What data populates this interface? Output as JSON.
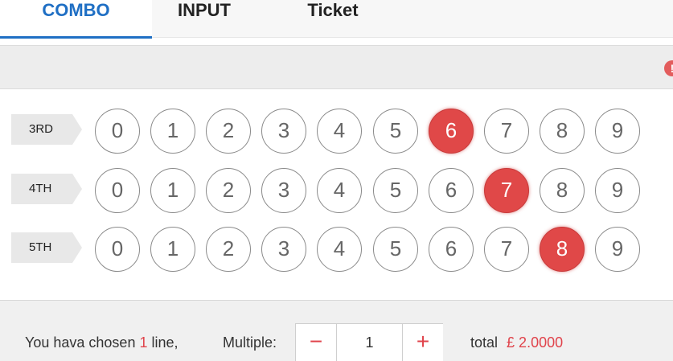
{
  "tabs": [
    {
      "label": "COMBO",
      "active": true
    },
    {
      "label": "INPUT",
      "active": false
    },
    {
      "label": "Ticket",
      "active": false
    }
  ],
  "info": {
    "icon": "info-icon",
    "glyph": "!"
  },
  "rows": [
    {
      "label": "3RD",
      "numbers": [
        "0",
        "1",
        "2",
        "3",
        "4",
        "5",
        "6",
        "7",
        "8",
        "9"
      ],
      "selected": "6"
    },
    {
      "label": "4TH",
      "numbers": [
        "0",
        "1",
        "2",
        "3",
        "4",
        "5",
        "6",
        "7",
        "8",
        "9"
      ],
      "selected": "7"
    },
    {
      "label": "5TH",
      "numbers": [
        "0",
        "1",
        "2",
        "3",
        "4",
        "5",
        "6",
        "7",
        "8",
        "9"
      ],
      "selected": "8"
    }
  ],
  "footer": {
    "prefix": "You hava chosen",
    "line_count": "1",
    "line_suffix": "line,",
    "multiple_label": "Multiple:",
    "minus": "−",
    "multiple_value": "1",
    "plus": "+",
    "total_label": "total",
    "total_value": "£ 2.0000"
  },
  "colors": {
    "accent": "#1f6fc4",
    "selected_ball": "#e04848",
    "highlight_text": "#e0434b"
  }
}
